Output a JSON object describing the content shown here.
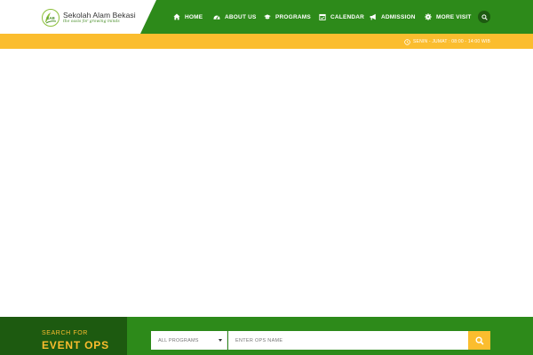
{
  "header": {
    "logo": {
      "title": "Sekolah Alam Bekasi",
      "tagline": "the oasis for growing minds",
      "mark_text": "SAB"
    },
    "nav": [
      {
        "label": "HOME",
        "icon": "home-icon"
      },
      {
        "label": "ABOUT US",
        "icon": "dashboard-icon"
      },
      {
        "label": "PROGRAMS",
        "icon": "graduation-cap-icon"
      },
      {
        "label": "CALENDAR",
        "icon": "calendar-icon"
      },
      {
        "label": "ADMISSION",
        "icon": "megaphone-icon"
      },
      {
        "label": "MORE VISIT",
        "icon": "gear-icon"
      }
    ],
    "search_icon": "search-icon"
  },
  "info_bar": {
    "hours": "SENIN - JUMAT : 08:00 - 14:00 WIB",
    "icon": "clock-icon"
  },
  "search_section": {
    "label_small": "SEARCH FOR",
    "label_big": "EVENT OPS",
    "select_value": "ALL PROGRAMS",
    "input_placeholder": "ENTER OPS NAME",
    "input_value": "",
    "button_icon": "search-icon"
  },
  "colors": {
    "green": "#2d8a1a",
    "dark_green": "#1d5a10",
    "yellow": "#fbbd2e"
  }
}
